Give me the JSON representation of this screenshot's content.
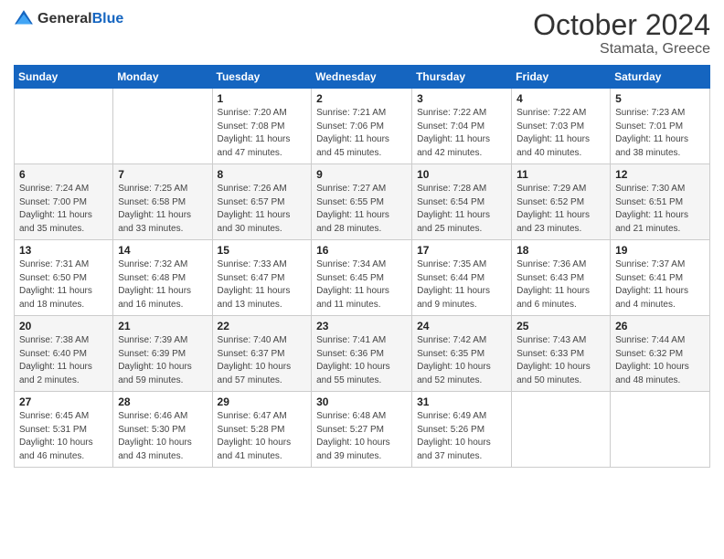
{
  "header": {
    "logo_general": "General",
    "logo_blue": "Blue",
    "month": "October 2024",
    "location": "Stamata, Greece"
  },
  "days_of_week": [
    "Sunday",
    "Monday",
    "Tuesday",
    "Wednesday",
    "Thursday",
    "Friday",
    "Saturday"
  ],
  "weeks": [
    [
      {
        "day": "",
        "info": ""
      },
      {
        "day": "",
        "info": ""
      },
      {
        "day": "1",
        "info": "Sunrise: 7:20 AM\nSunset: 7:08 PM\nDaylight: 11 hours and 47 minutes."
      },
      {
        "day": "2",
        "info": "Sunrise: 7:21 AM\nSunset: 7:06 PM\nDaylight: 11 hours and 45 minutes."
      },
      {
        "day": "3",
        "info": "Sunrise: 7:22 AM\nSunset: 7:04 PM\nDaylight: 11 hours and 42 minutes."
      },
      {
        "day": "4",
        "info": "Sunrise: 7:22 AM\nSunset: 7:03 PM\nDaylight: 11 hours and 40 minutes."
      },
      {
        "day": "5",
        "info": "Sunrise: 7:23 AM\nSunset: 7:01 PM\nDaylight: 11 hours and 38 minutes."
      }
    ],
    [
      {
        "day": "6",
        "info": "Sunrise: 7:24 AM\nSunset: 7:00 PM\nDaylight: 11 hours and 35 minutes."
      },
      {
        "day": "7",
        "info": "Sunrise: 7:25 AM\nSunset: 6:58 PM\nDaylight: 11 hours and 33 minutes."
      },
      {
        "day": "8",
        "info": "Sunrise: 7:26 AM\nSunset: 6:57 PM\nDaylight: 11 hours and 30 minutes."
      },
      {
        "day": "9",
        "info": "Sunrise: 7:27 AM\nSunset: 6:55 PM\nDaylight: 11 hours and 28 minutes."
      },
      {
        "day": "10",
        "info": "Sunrise: 7:28 AM\nSunset: 6:54 PM\nDaylight: 11 hours and 25 minutes."
      },
      {
        "day": "11",
        "info": "Sunrise: 7:29 AM\nSunset: 6:52 PM\nDaylight: 11 hours and 23 minutes."
      },
      {
        "day": "12",
        "info": "Sunrise: 7:30 AM\nSunset: 6:51 PM\nDaylight: 11 hours and 21 minutes."
      }
    ],
    [
      {
        "day": "13",
        "info": "Sunrise: 7:31 AM\nSunset: 6:50 PM\nDaylight: 11 hours and 18 minutes."
      },
      {
        "day": "14",
        "info": "Sunrise: 7:32 AM\nSunset: 6:48 PM\nDaylight: 11 hours and 16 minutes."
      },
      {
        "day": "15",
        "info": "Sunrise: 7:33 AM\nSunset: 6:47 PM\nDaylight: 11 hours and 13 minutes."
      },
      {
        "day": "16",
        "info": "Sunrise: 7:34 AM\nSunset: 6:45 PM\nDaylight: 11 hours and 11 minutes."
      },
      {
        "day": "17",
        "info": "Sunrise: 7:35 AM\nSunset: 6:44 PM\nDaylight: 11 hours and 9 minutes."
      },
      {
        "day": "18",
        "info": "Sunrise: 7:36 AM\nSunset: 6:43 PM\nDaylight: 11 hours and 6 minutes."
      },
      {
        "day": "19",
        "info": "Sunrise: 7:37 AM\nSunset: 6:41 PM\nDaylight: 11 hours and 4 minutes."
      }
    ],
    [
      {
        "day": "20",
        "info": "Sunrise: 7:38 AM\nSunset: 6:40 PM\nDaylight: 11 hours and 2 minutes."
      },
      {
        "day": "21",
        "info": "Sunrise: 7:39 AM\nSunset: 6:39 PM\nDaylight: 10 hours and 59 minutes."
      },
      {
        "day": "22",
        "info": "Sunrise: 7:40 AM\nSunset: 6:37 PM\nDaylight: 10 hours and 57 minutes."
      },
      {
        "day": "23",
        "info": "Sunrise: 7:41 AM\nSunset: 6:36 PM\nDaylight: 10 hours and 55 minutes."
      },
      {
        "day": "24",
        "info": "Sunrise: 7:42 AM\nSunset: 6:35 PM\nDaylight: 10 hours and 52 minutes."
      },
      {
        "day": "25",
        "info": "Sunrise: 7:43 AM\nSunset: 6:33 PM\nDaylight: 10 hours and 50 minutes."
      },
      {
        "day": "26",
        "info": "Sunrise: 7:44 AM\nSunset: 6:32 PM\nDaylight: 10 hours and 48 minutes."
      }
    ],
    [
      {
        "day": "27",
        "info": "Sunrise: 6:45 AM\nSunset: 5:31 PM\nDaylight: 10 hours and 46 minutes."
      },
      {
        "day": "28",
        "info": "Sunrise: 6:46 AM\nSunset: 5:30 PM\nDaylight: 10 hours and 43 minutes."
      },
      {
        "day": "29",
        "info": "Sunrise: 6:47 AM\nSunset: 5:28 PM\nDaylight: 10 hours and 41 minutes."
      },
      {
        "day": "30",
        "info": "Sunrise: 6:48 AM\nSunset: 5:27 PM\nDaylight: 10 hours and 39 minutes."
      },
      {
        "day": "31",
        "info": "Sunrise: 6:49 AM\nSunset: 5:26 PM\nDaylight: 10 hours and 37 minutes."
      },
      {
        "day": "",
        "info": ""
      },
      {
        "day": "",
        "info": ""
      }
    ]
  ]
}
